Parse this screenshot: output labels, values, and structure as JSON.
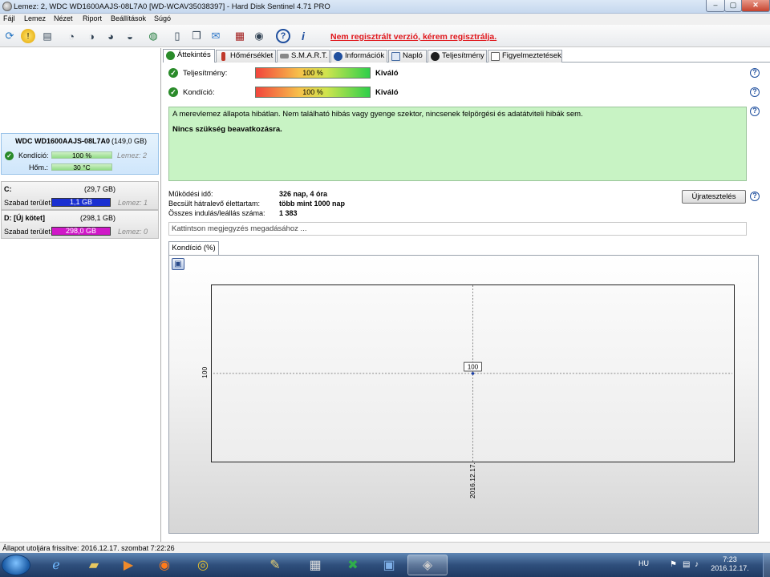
{
  "window": {
    "title": "Lemez: 2, WDC WD1600AAJS-08L7A0 [WD-WCAV35038397]  -  Hard Disk Sentinel 4.71 PRO",
    "minimize": "–",
    "maximize": "▢",
    "close": "✕"
  },
  "menu": [
    "Fájl",
    "Lemez",
    "Nézet",
    "Riport",
    "Beállítások",
    "Súgó"
  ],
  "toolbar": {
    "registration_link": "Nem regisztrált verzió, kérem regisztrálja."
  },
  "disk": {
    "name": "WDC WD1600AAJS-08L7A0",
    "size": "(149,0 GB)",
    "health_label": "Kondíció:",
    "health_value": "100 %",
    "health_percent": 100,
    "disk_index": "Lemez: 2",
    "temp_label": "Hőm.:",
    "temp_value": "30 °C"
  },
  "volumes": [
    {
      "name": "C:",
      "size": "(29,7 GB)",
      "free_label": "Szabad terület",
      "free_value": "1,1 GB",
      "disk": "Lemez: 1",
      "color": "#1a2fd1"
    },
    {
      "name": "D: [Új kötet]",
      "size": "(298,1 GB)",
      "free_label": "Szabad terület",
      "free_value": "298,0 GB",
      "disk": "Lemez: 0",
      "color": "#d018c8"
    }
  ],
  "tabs": [
    {
      "label": "Áttekintés",
      "icon": "check-icon"
    },
    {
      "label": "Hőmérséklet",
      "icon": "thermometer-icon"
    },
    {
      "label": "S.M.A.R.T.",
      "icon": "smart-icon"
    },
    {
      "label": "Információk",
      "icon": "info-icon"
    },
    {
      "label": "Napló",
      "icon": "log-icon"
    },
    {
      "label": "Teljesítmény",
      "icon": "performance-icon"
    },
    {
      "label": "Figyelmeztetések",
      "icon": "alerts-icon"
    }
  ],
  "overview": {
    "performance_label": "Teljesítmény:",
    "performance_value": "100 %",
    "performance_rating": "Kiváló",
    "health_label": "Kondíció:",
    "health_value": "100 %",
    "health_rating": "Kiváló",
    "status_text": "A merevlemez állapota hibátlan. Nem található hibás vagy gyenge szektor, nincsenek felpörgési és adatátviteli hibák sem.",
    "action_text": "Nincs szükség beavatkozásra.",
    "power_on_label": "Működési idő:",
    "power_on_value": "326 nap, 4 óra",
    "remaining_label": "Becsült hátralevő élettartam:",
    "remaining_value": "több mint 1000 nap",
    "startstop_label": "Összes indulás/leállás száma:",
    "startstop_value": "1 383",
    "restart_button": "Újratesztelés",
    "note_placeholder": "Kattintson megjegyzés megadásához ...",
    "graph_tab": "Kondíció  (%)"
  },
  "chart_data": {
    "type": "line",
    "x": [
      "2016.12.17."
    ],
    "series": [
      {
        "values": [
          100
        ]
      }
    ],
    "y_tick": "100",
    "point_label": "100",
    "grid": true
  },
  "statusbar": {
    "text": "Állapot utoljára frissítve: 2016.12.17. szombat 7:22:26"
  },
  "taskbar": {
    "language": "HU",
    "time": "7:23",
    "date": "2016.12.17."
  }
}
